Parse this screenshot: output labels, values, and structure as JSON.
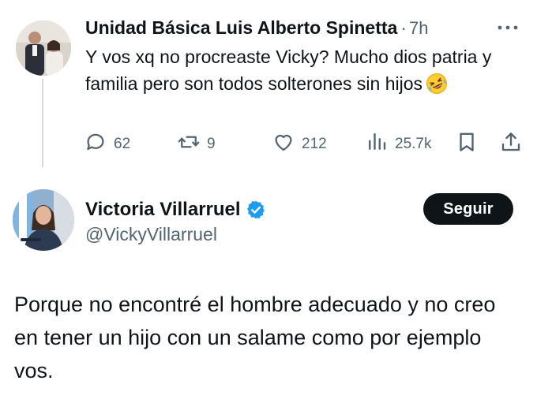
{
  "reply_tweet": {
    "author_name": "Unidad Básica Luis Alberto Spinetta",
    "separator": "·",
    "time": "7h",
    "text": "Y vos xq no procreaste Vicky? Mucho dios patria y familia pero son todos solterones sin hijos",
    "emoji": "rolling-on-floor-laughing",
    "actions": {
      "replies": "62",
      "retweets": "9",
      "likes": "212",
      "views": "25.7k"
    }
  },
  "main_tweet": {
    "author_name": "Victoria Villarruel",
    "verified": true,
    "handle": "@VickyVillarruel",
    "follow_label": "Seguir",
    "text": "Porque no encontré el hombre adecuado y no creo en tener un hijo con un salame como por ejemplo vos."
  },
  "colors": {
    "text_primary": "#0f1419",
    "text_secondary": "#536471",
    "verified_blue": "#1d9bf0",
    "follow_button_bg": "#0f1419",
    "thread_line": "#d5dadd"
  },
  "icons": [
    "more-icon",
    "reply-icon",
    "retweet-icon",
    "like-icon",
    "views-icon",
    "bookmark-icon",
    "share-icon",
    "verified-badge-icon"
  ]
}
